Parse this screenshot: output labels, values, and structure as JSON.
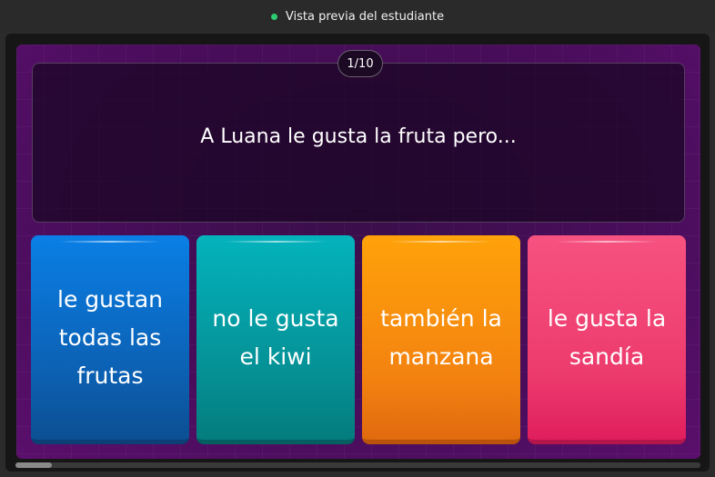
{
  "header": {
    "status_label": "Vista previa del estudiante",
    "status_color": "#2ecc71"
  },
  "quiz": {
    "counter": "1/10",
    "question": "A Luana le gusta la fruta pero...",
    "options": [
      {
        "label": "le gustan todas las frutas",
        "color": "#0c5fb0"
      },
      {
        "label": "no le gusta el kiwi",
        "color": "#058f93"
      },
      {
        "label": "también la manzana",
        "color": "#f38210"
      },
      {
        "label": "le gusta la sandía",
        "color": "#ec3a6c"
      }
    ]
  }
}
